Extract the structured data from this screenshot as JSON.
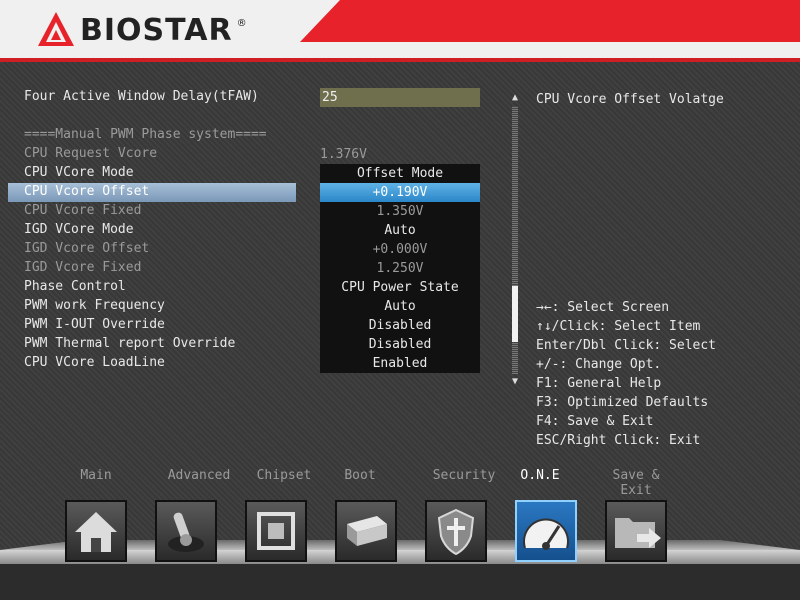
{
  "header": {
    "brand": "BIOSTAR",
    "brand_mark": "®",
    "colors": {
      "accent": "#e8222a",
      "header_bg": "#f0f0f0"
    }
  },
  "settings": [
    {
      "label": "Four Active Window Delay(tFAW)",
      "value": "25"
    },
    {
      "label": "====Manual PWM Phase system====",
      "value": ""
    },
    {
      "label": "CPU Request Vcore",
      "value": "1.376V"
    },
    {
      "label": "CPU VCore Mode",
      "value": "Offset Mode"
    },
    {
      "label": "CPU Vcore Offset",
      "value": "+0.190V"
    },
    {
      "label": "CPU Vcore Fixed",
      "value": "1.350V"
    },
    {
      "label": "IGD VCore Mode",
      "value": "Auto"
    },
    {
      "label": "IGD Vcore Offset",
      "value": "+0.000V"
    },
    {
      "label": "IGD Vcore Fixed",
      "value": "1.250V"
    },
    {
      "label": "Phase Control",
      "value": "CPU Power State"
    },
    {
      "label": "PWM work Frequency",
      "value": "Auto"
    },
    {
      "label": "PWM I-OUT Override",
      "value": "Disabled"
    },
    {
      "label": "PWM Thermal report Override",
      "value": "Disabled"
    },
    {
      "label": "CPU VCore LoadLine",
      "value": "Enabled"
    }
  ],
  "help": {
    "title": "CPU Vcore Offset Volatge",
    "keys": [
      "→←: Select Screen",
      "↑↓/Click: Select Item",
      "Enter/Dbl Click: Select",
      "+/-: Change Opt.",
      "F1: General Help",
      "F3: Optimized Defaults",
      "F4: Save & Exit",
      "ESC/Right Click: Exit"
    ]
  },
  "scroll": {
    "position": 0.85
  },
  "nav": {
    "tabs": [
      {
        "label": "Main",
        "icon": "home-icon"
      },
      {
        "label": "Advanced",
        "icon": "joystick-icon"
      },
      {
        "label": "Chipset",
        "icon": "chip-icon"
      },
      {
        "label": "Boot",
        "icon": "drive-icon"
      },
      {
        "label": "Security",
        "icon": "shield-icon"
      },
      {
        "label": "O.N.E",
        "icon": "gauge-icon"
      },
      {
        "label": "Save & Exit",
        "icon": "folder-exit-icon"
      }
    ],
    "active": "O.N.E"
  }
}
